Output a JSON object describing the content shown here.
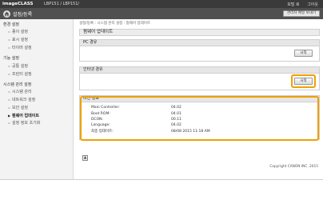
{
  "header": {
    "brand": "imageCLASS",
    "model": "LBP151 / LBP151/",
    "links": [
      "포털 로",
      "그아웃"
    ]
  },
  "titlebar": {
    "title": "설정/등록",
    "mail_button": "관리자 메일 보내기"
  },
  "sidebar": {
    "sections": [
      {
        "heading": "환경 설정",
        "items": [
          "종이 설정",
          "표시 설정",
          "타이머 설정"
        ]
      },
      {
        "heading": "기능 설정",
        "items": [
          "공통 설정",
          "프린터 설정"
        ]
      },
      {
        "heading": "시스템 관리 설정",
        "items": [
          "시스템 관리",
          "네트워크 설정",
          "보안 설정",
          "펌웨어 업데이트",
          "설정 정보 초기화"
        ]
      }
    ],
    "active_item": "펌웨어 업데이트"
  },
  "main": {
    "breadcrumb": "설정/등록 : 시스템 관리 설정 : 펌웨어 업데이트",
    "title": "펌웨어 업데이트",
    "pc_section": {
      "header": "PC 경유",
      "button": "시작"
    },
    "internet_section": {
      "header": "인터넷 경유",
      "button": "시작"
    },
    "version_section": {
      "header": "버전 정보",
      "rows": [
        {
          "key": "Main Controller:",
          "value": "04.02"
        },
        {
          "key": "Boot ROM:",
          "value": "04.01"
        },
        {
          "key": "DCON:",
          "value": "00.11"
        },
        {
          "key": "Language:",
          "value": "04.02"
        },
        {
          "key": "최종 업데이트:",
          "value": "08/08 2015 11:18 AM"
        }
      ]
    }
  },
  "footer": {
    "copyright": "Copyright CANON INC. 2015"
  },
  "colors": {
    "highlight": "#f0a000",
    "topbar": "#3a3a3a",
    "titlebar": "#505050"
  }
}
